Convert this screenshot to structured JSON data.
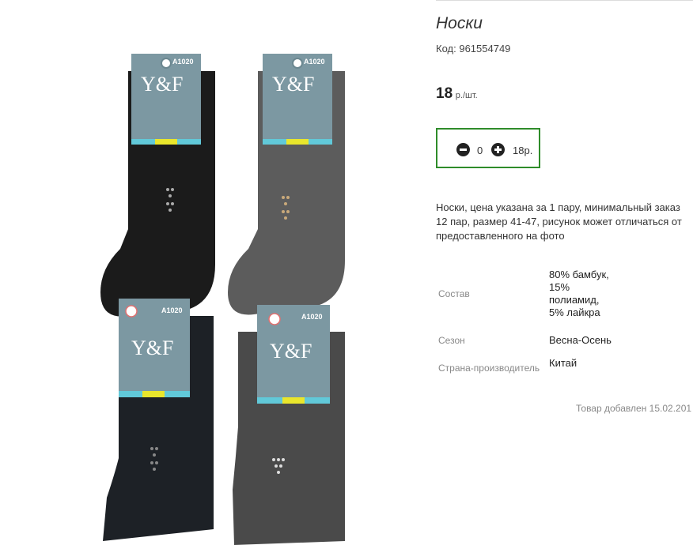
{
  "product": {
    "title": "Носки",
    "code_label": "Код:",
    "code_value": "961554749",
    "price_value": "18",
    "price_unit": "р./шт.",
    "quantity": "0",
    "total": "18р.",
    "description": "Носки, цена указана за 1 пару, минимальный заказ 12 пар, размер 41-47, рисунок может отличаться от предоставленного на фото",
    "properties": [
      {
        "key": "Состав",
        "value": "80% бамбук, 15% полиамид, 5% лайкра"
      },
      {
        "key": "Сезон",
        "value": "Весна-Осень"
      },
      {
        "key": "Страна-производитель",
        "value": "Китай"
      }
    ],
    "added": "Товар добавлен 15.02.201"
  },
  "image": {
    "brand": "Y&F",
    "model": "A1020",
    "size": "41-47",
    "sock_colors": [
      "#1b1b1b",
      "#5c5c5c",
      "#1d2126",
      "#4a4a4a"
    ],
    "tag_color": "#7c98a2",
    "accent_cyan": "#61c9d9",
    "accent_yellow": "#e9e62c"
  },
  "colors": {
    "box_border": "#2f8c2a"
  }
}
